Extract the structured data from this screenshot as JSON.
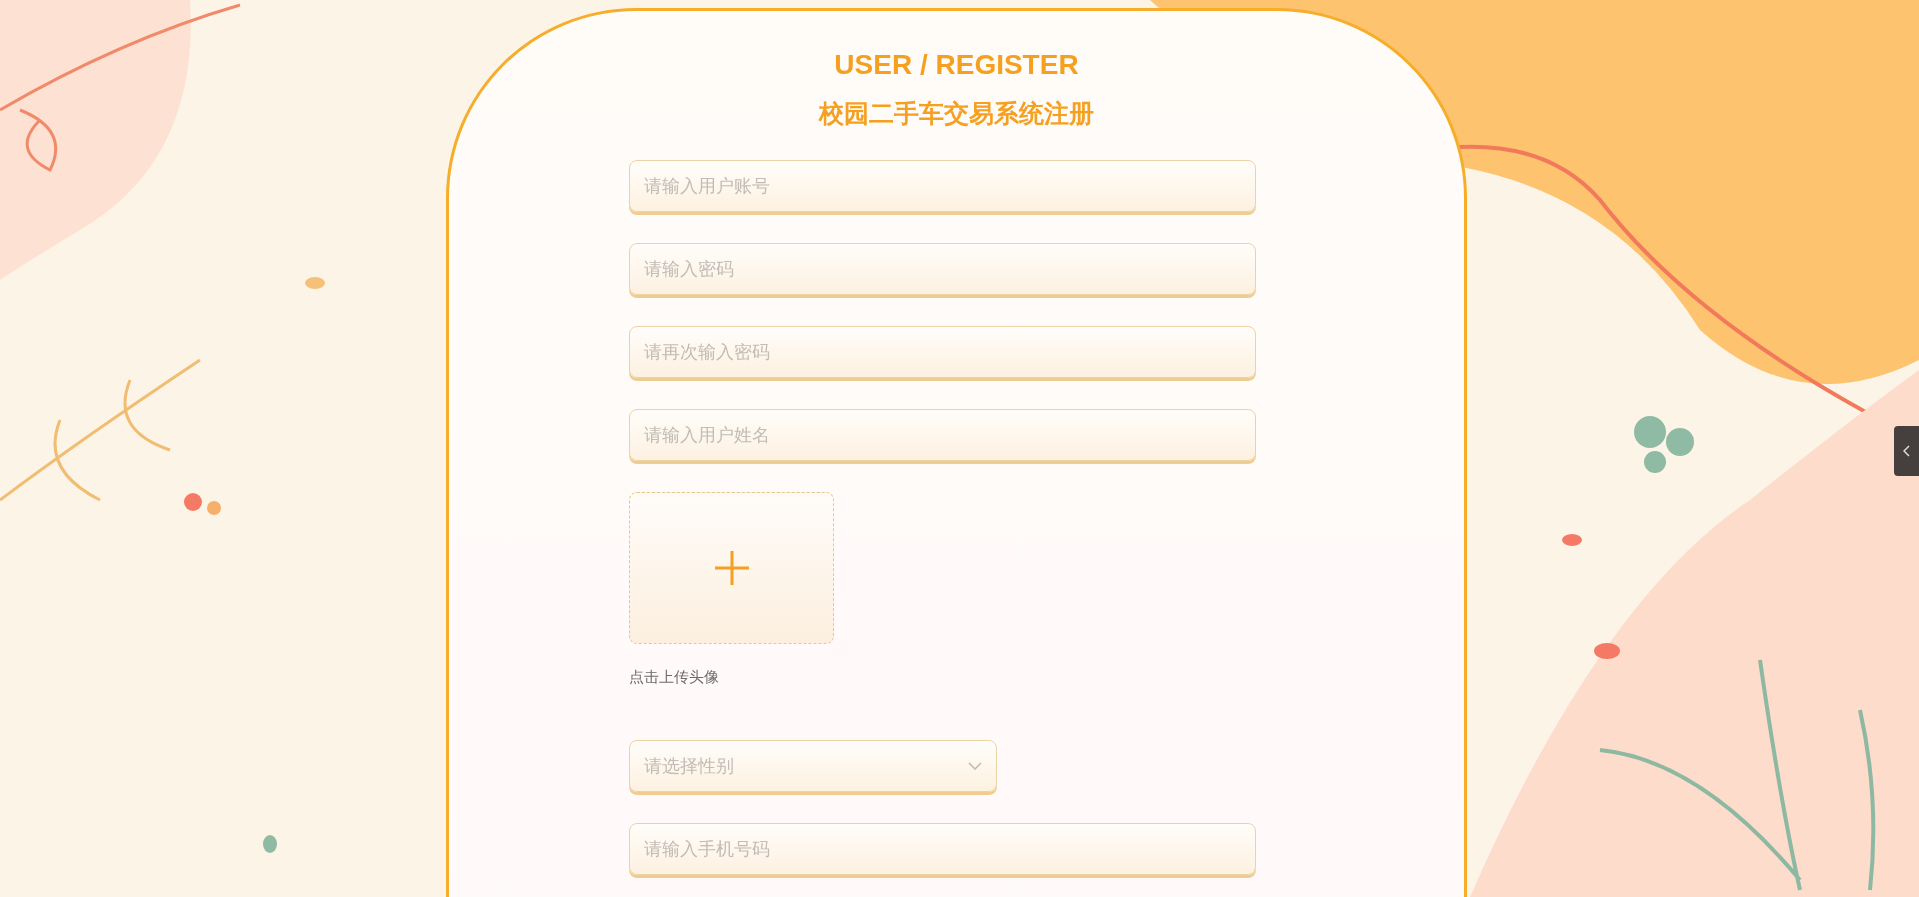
{
  "header": {
    "title": "USER / REGISTER",
    "subtitle": "校园二手车交易系统注册"
  },
  "fields": [
    {
      "kind": "text",
      "placeholder": "请输入用户账号"
    },
    {
      "kind": "password",
      "placeholder": "请输入密码"
    },
    {
      "kind": "password",
      "placeholder": "请再次输入密码"
    },
    {
      "kind": "text",
      "placeholder": "请输入用户姓名"
    },
    {
      "kind": "upload",
      "label": "点击上传头像"
    },
    {
      "kind": "select",
      "placeholder": "请选择性别"
    },
    {
      "kind": "text",
      "placeholder": "请输入手机号码"
    }
  ]
}
